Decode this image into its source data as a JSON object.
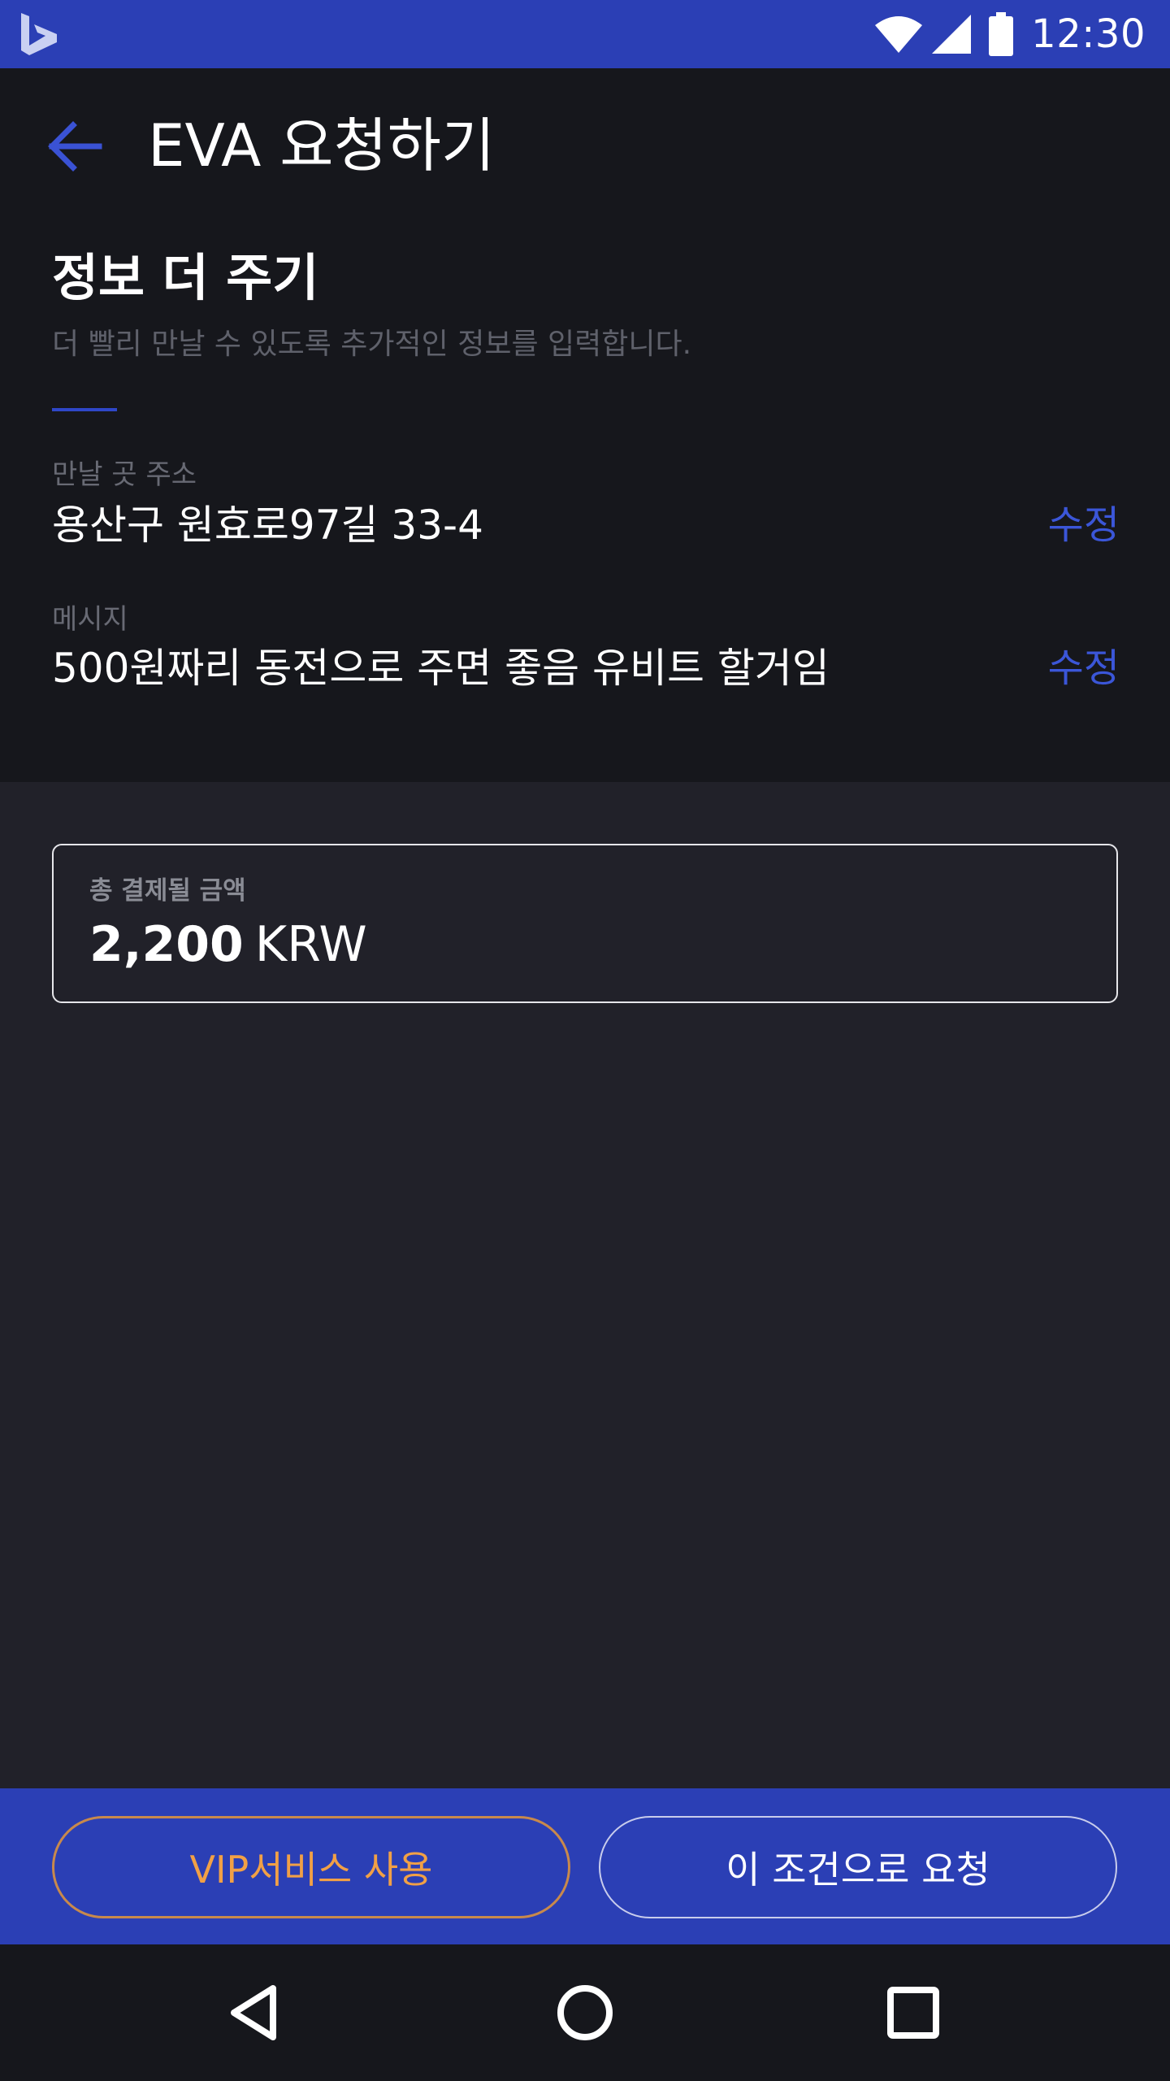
{
  "status_bar": {
    "time": "12:30",
    "icons": [
      "bing-logo-icon",
      "wifi-icon",
      "signal-icon",
      "battery-icon"
    ]
  },
  "header": {
    "title": "EVA 요청하기",
    "back_icon": "arrow-left-icon"
  },
  "info_section": {
    "title": "정보 더 주기",
    "subtitle": "더 빨리 만날 수 있도록 추가적인 정보를 입력합니다.",
    "fields": [
      {
        "label": "만날 곳 주소",
        "value": "용산구 원효로97길 33-4",
        "edit_label": "수정"
      },
      {
        "label": "메시지",
        "value": "500원짜리 동전으로 주면 좋음 유비트 할거임",
        "edit_label": "수정"
      }
    ]
  },
  "total": {
    "label": "총 결제될 금액",
    "amount": "2,200",
    "currency": "KRW"
  },
  "actions": {
    "vip_label": "VIP서비스 사용",
    "request_label": "이 조건으로 요청"
  },
  "nav_bar": {
    "icons": [
      "back-triangle-icon",
      "home-circle-icon",
      "recents-square-icon"
    ]
  },
  "colors": {
    "primary": "#2b3fb5",
    "accent_link": "#3b56d8",
    "vip_orange": "#f1a046",
    "dark_bg": "#16171c",
    "panel_bg": "#212129"
  }
}
